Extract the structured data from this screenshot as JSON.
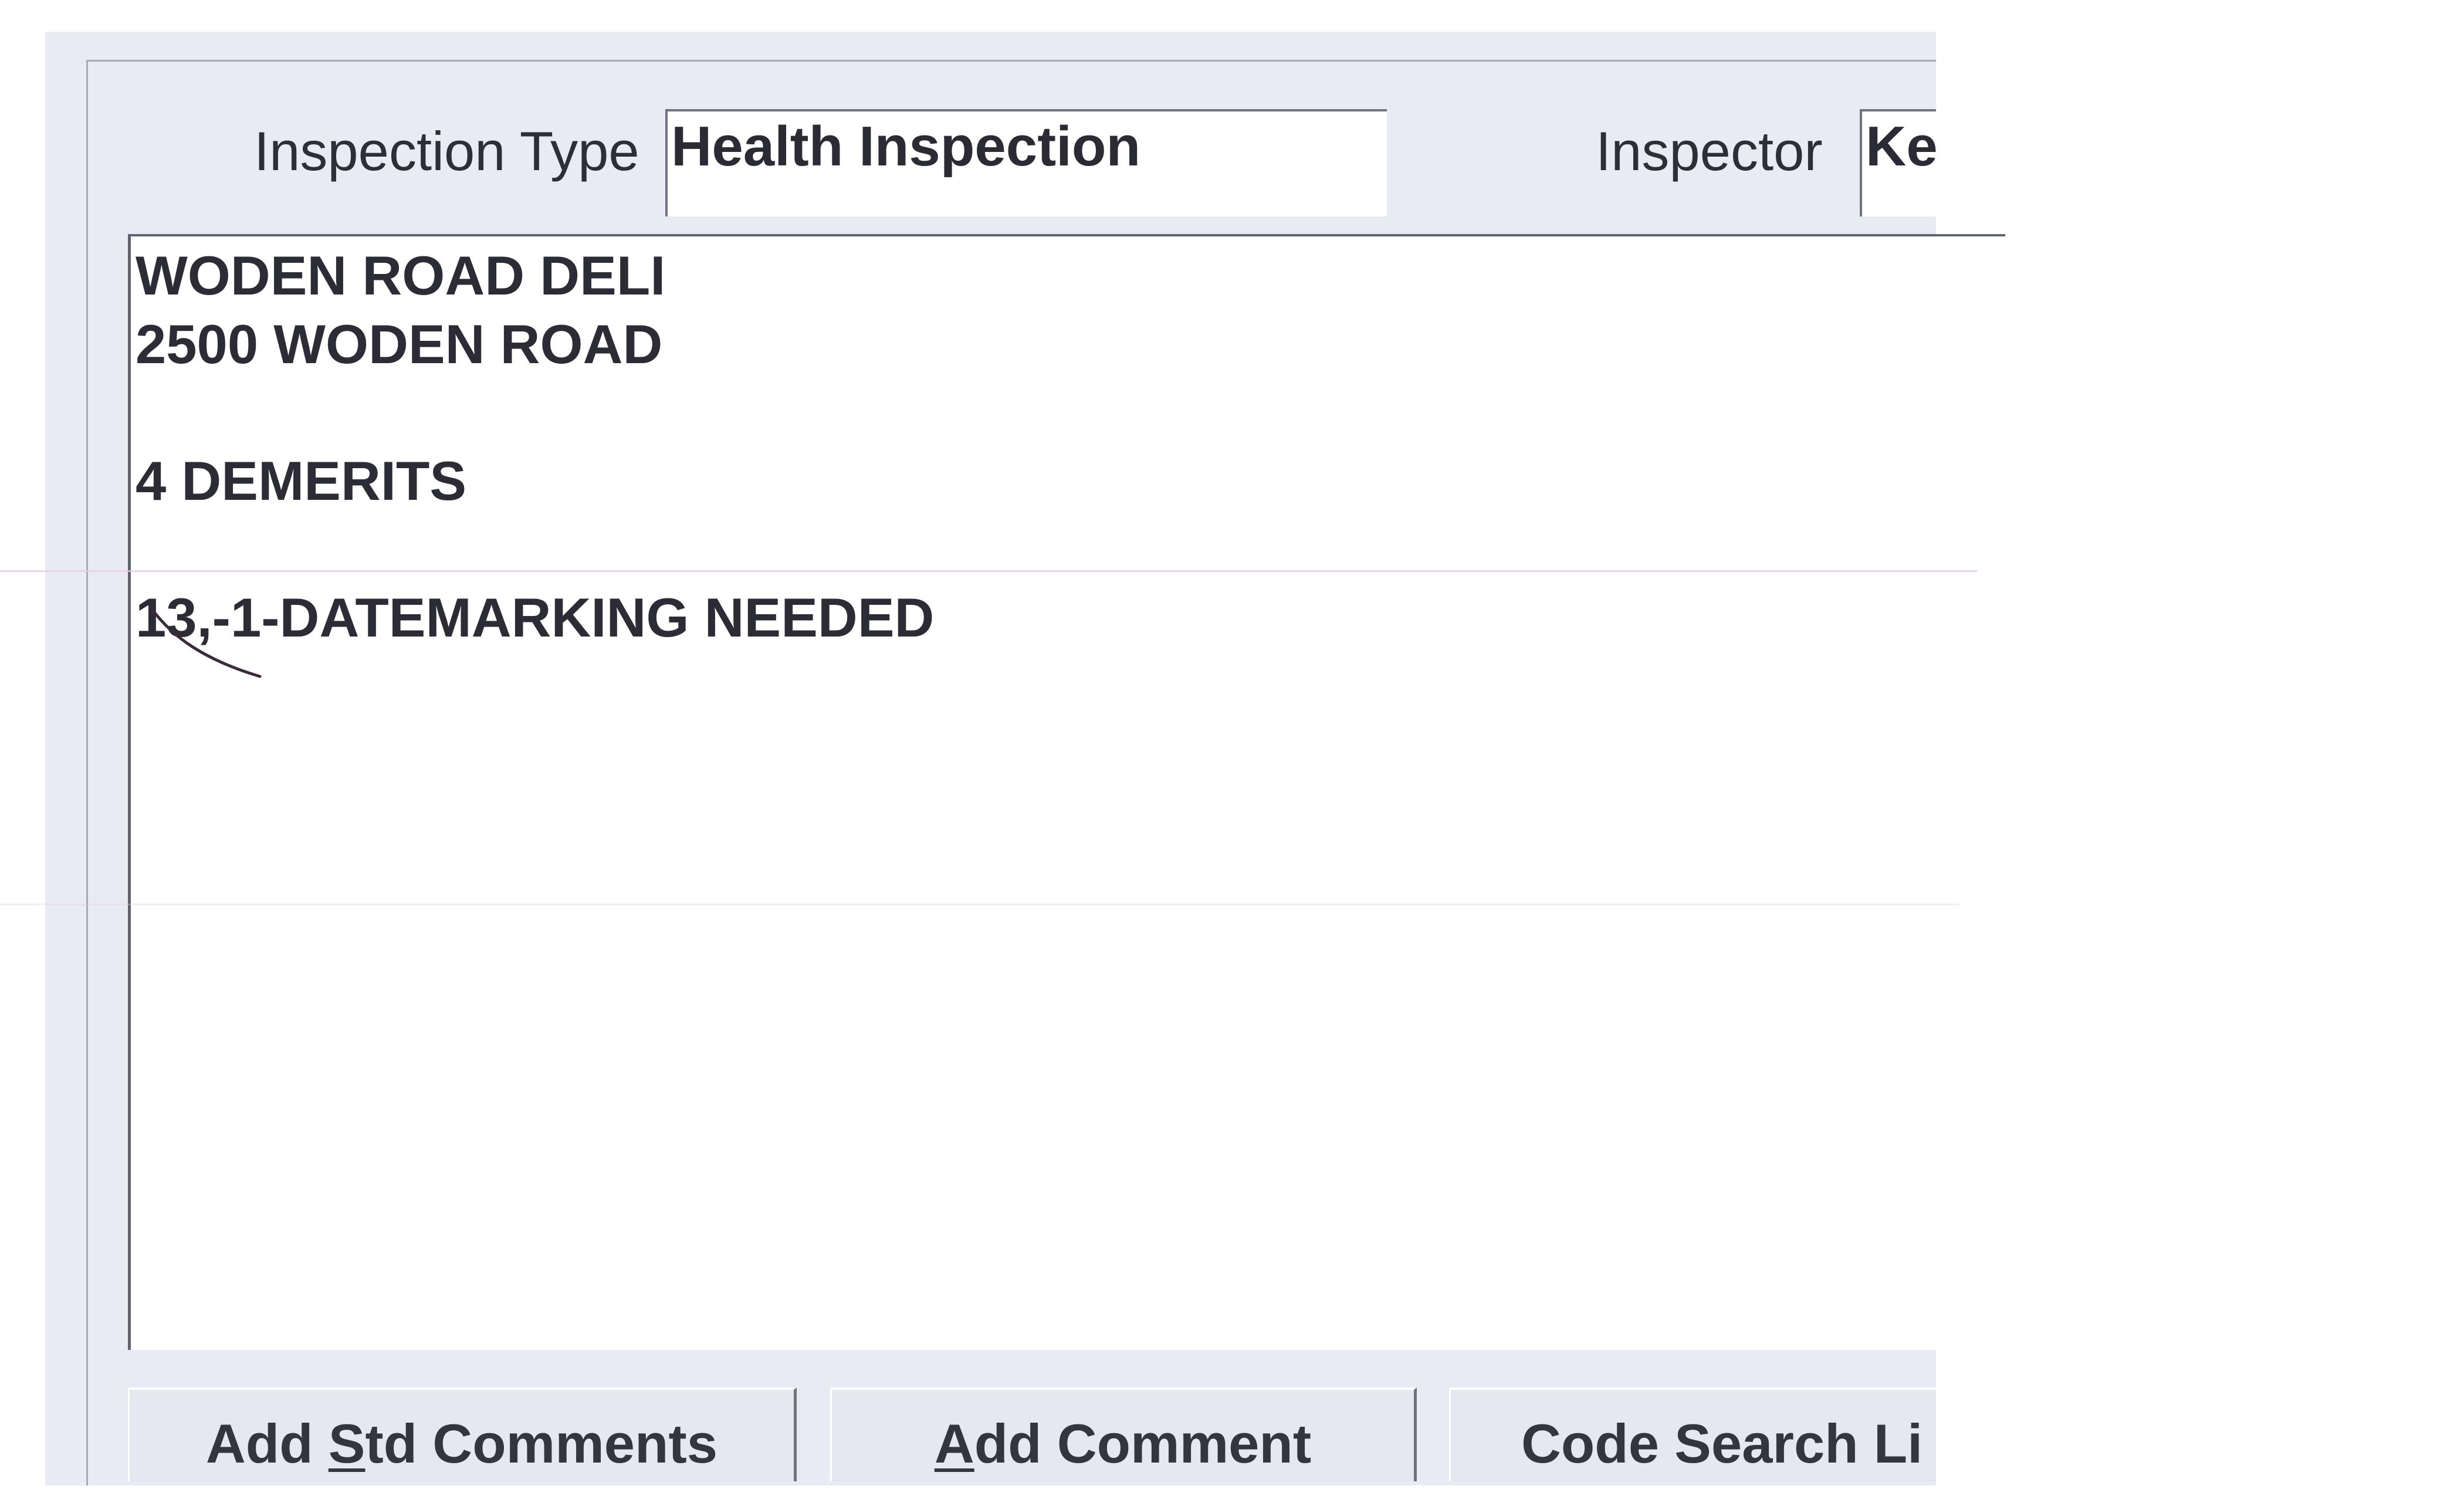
{
  "form": {
    "inspection_type_label": "Inspection Type",
    "inspection_type_value": "Health Inspection",
    "inspector_label": "Inspector",
    "inspector_value": "Ke"
  },
  "comments": {
    "lines": [
      "WODEN ROAD DELI",
      "2500 WODEN ROAD",
      "4 DEMERITS",
      "13,-1-DATEMARKING NEEDED"
    ]
  },
  "buttons": {
    "add_std_comments": {
      "before": "Add ",
      "mnemonic": "S",
      "after": "td Comments"
    },
    "add_comment": {
      "before": "",
      "mnemonic": "A",
      "after": "dd Comment"
    },
    "code_search": {
      "label": "Code Search Li"
    }
  }
}
